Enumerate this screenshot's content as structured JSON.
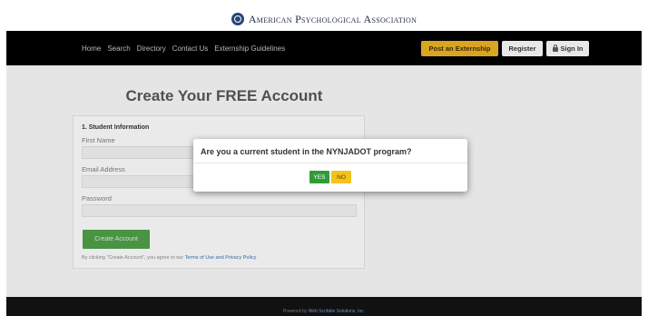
{
  "brand": {
    "name": "American Psychological Association",
    "logo_icon": "apa-logo-icon"
  },
  "nav": {
    "links": [
      "Home",
      "Search",
      "Directory",
      "Contact Us",
      "Externship Guidelines"
    ],
    "post_button": "Post an Externship",
    "register_button": "Register",
    "signin_button": "Sign In"
  },
  "heading": "Create Your FREE Account",
  "form": {
    "section_title": "1. Student Information",
    "first_name_label": "First Name",
    "email_label": "Email Address",
    "password_label": "Password",
    "submit_label": "Create Account",
    "terms_prefix": "By clicking \"Create Account\", you agree to our",
    "terms_link": "Terms of Use and Privacy Policy"
  },
  "modal": {
    "question": "Are you a current student in the NYNJADOT program?",
    "yes_label": "YES",
    "no_label": "NO"
  },
  "footer": {
    "prefix": "Powered by",
    "link": "Web Scribble Solutions, Inc."
  },
  "colors": {
    "nav_background": "#000000",
    "post_button": "#d9a521",
    "create_button": "#4e9a48",
    "yes_button": "#2f9d36",
    "no_button": "#f4c21b"
  }
}
